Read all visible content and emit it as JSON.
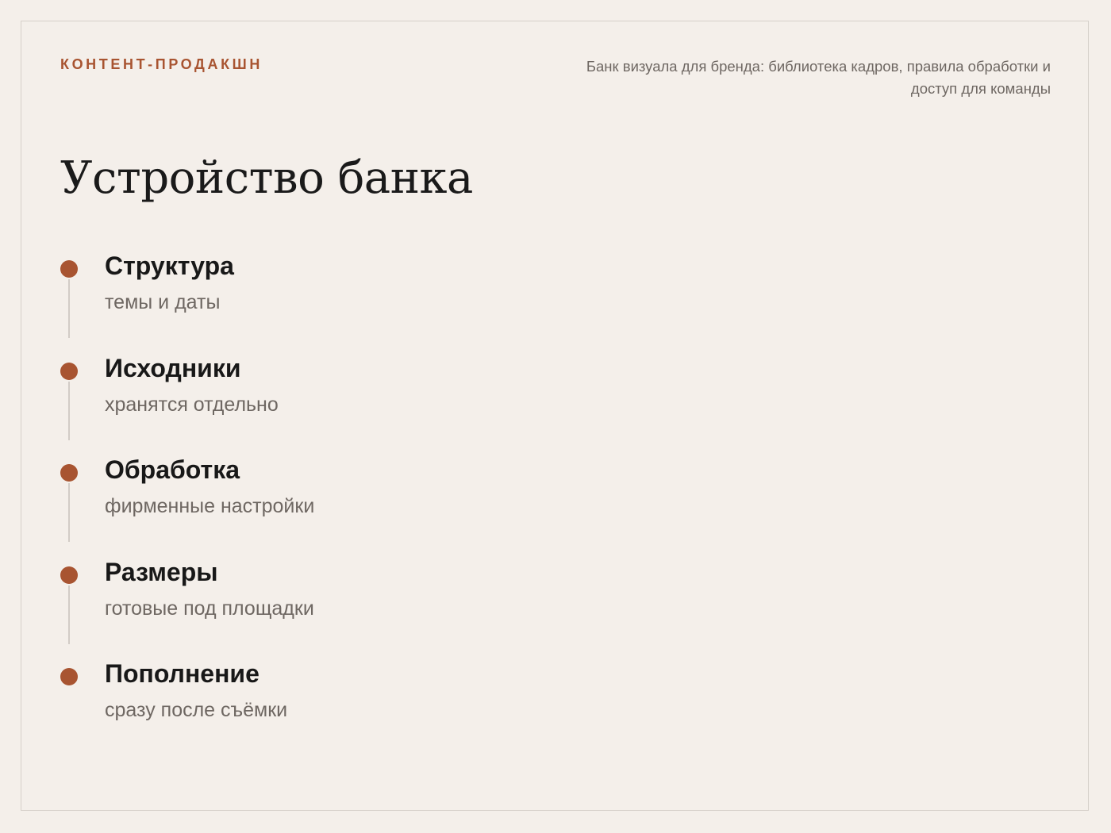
{
  "header": {
    "eyebrow": "КОНТЕНТ-ПРОДАКШН",
    "subtitle": "Банк визуала для бренда: библиотека кадров, правила обработки и доступ для команды"
  },
  "title": "Устройство банка",
  "steps": [
    {
      "title": "Структура",
      "description": "темы и даты"
    },
    {
      "title": "Исходники",
      "description": "хранятся отдельно"
    },
    {
      "title": "Обработка",
      "description": "фирменные настройки"
    },
    {
      "title": "Размеры",
      "description": "готовые под площадки"
    },
    {
      "title": "Пополнение",
      "description": "сразу после съёмки"
    }
  ],
  "colors": {
    "accent": "#a85431",
    "background": "#f4efea",
    "text": "#1a1a1a",
    "muted": "#6e6762"
  }
}
